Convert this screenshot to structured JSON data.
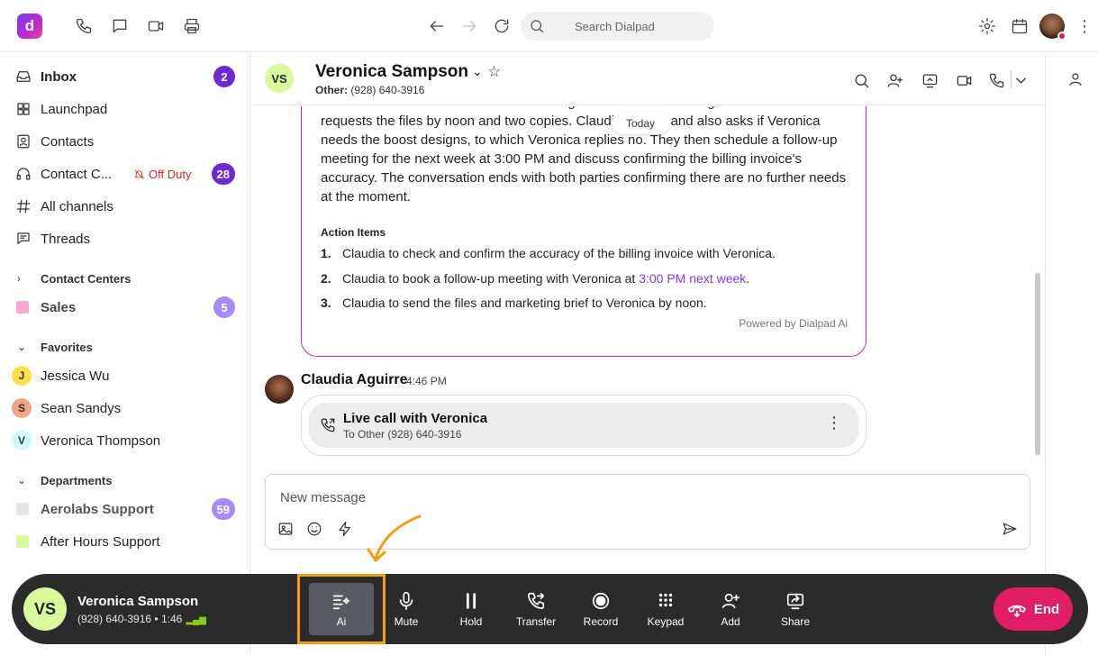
{
  "topbar": {
    "logo": "d",
    "search_placeholder": "Search Dialpad"
  },
  "sidebar": {
    "items": [
      {
        "label": "Inbox",
        "badge": "2"
      },
      {
        "label": "Launchpad"
      },
      {
        "label": "Contacts"
      },
      {
        "label": "Contact C...",
        "status": "Off Duty",
        "badge": "28"
      },
      {
        "label": "All channels"
      },
      {
        "label": "Threads"
      }
    ],
    "contact_centers": {
      "heading": "Contact Centers",
      "items": [
        {
          "label": "Sales",
          "badge": "5"
        }
      ]
    },
    "favorites": {
      "heading": "Favorites",
      "items": [
        {
          "initial": "J",
          "label": "Jessica Wu"
        },
        {
          "initial": "S",
          "label": "Sean Sandys"
        },
        {
          "initial": "V",
          "label": "Veronica Thompson"
        }
      ]
    },
    "departments": {
      "heading": "Departments",
      "items": [
        {
          "label": "Aerolabs Support",
          "badge": "59"
        },
        {
          "label": "After Hours Support"
        }
      ]
    }
  },
  "conversation": {
    "initials": "VS",
    "name": "Veronica Sampson",
    "sub_label": "Other:",
    "sub_number": "(928) 640-3916",
    "summary_text": "Claudia and Veronica discuss the exchange of files and marketing brief. Veronica requests the files by noon and two copies. Claudia agrees and also asks if Veronica needs the boost designs, to which Veronica replies no. They then schedule a follow-up meeting for the next week at 3:00 PM and discuss confirming the billing invoice's accuracy. The conversation ends with both parties confirming there are no further needs at the moment.",
    "today_label": "Today",
    "action_items_title": "Action Items",
    "action_items": [
      {
        "num": "1.",
        "text": "Claudia to check and confirm the accuracy of the billing invoice with Veronica."
      },
      {
        "num": "2.",
        "text": "Claudia to book a follow-up meeting with Veronica at ",
        "link": "3:00 PM next week",
        "after": "."
      },
      {
        "num": "3.",
        "text": "Claudia to send the files and marketing brief to Veronica by noon."
      }
    ],
    "powered_by": "Powered by Dialpad Ai",
    "message": {
      "sender": "Claudia Aguirre",
      "time": "4:46 PM",
      "call_title": "Live call with Veronica",
      "call_sub": "To Other (928) 640-3916"
    },
    "composer_placeholder": "New message"
  },
  "callbar": {
    "initials": "VS",
    "name": "Veronica Sampson",
    "number": "(928) 640-3916",
    "separator": "•",
    "duration": "1:46",
    "buttons": [
      {
        "label": "Ai"
      },
      {
        "label": "Mute"
      },
      {
        "label": "Hold"
      },
      {
        "label": "Transfer"
      },
      {
        "label": "Record"
      },
      {
        "label": "Keypad"
      },
      {
        "label": "Add"
      },
      {
        "label": "Share"
      }
    ],
    "end_label": "End"
  },
  "colors": {
    "accent": "#6d28d9",
    "end": "#e11d63",
    "highlight": "#f59e0b",
    "ai_border": "#c026d3"
  }
}
